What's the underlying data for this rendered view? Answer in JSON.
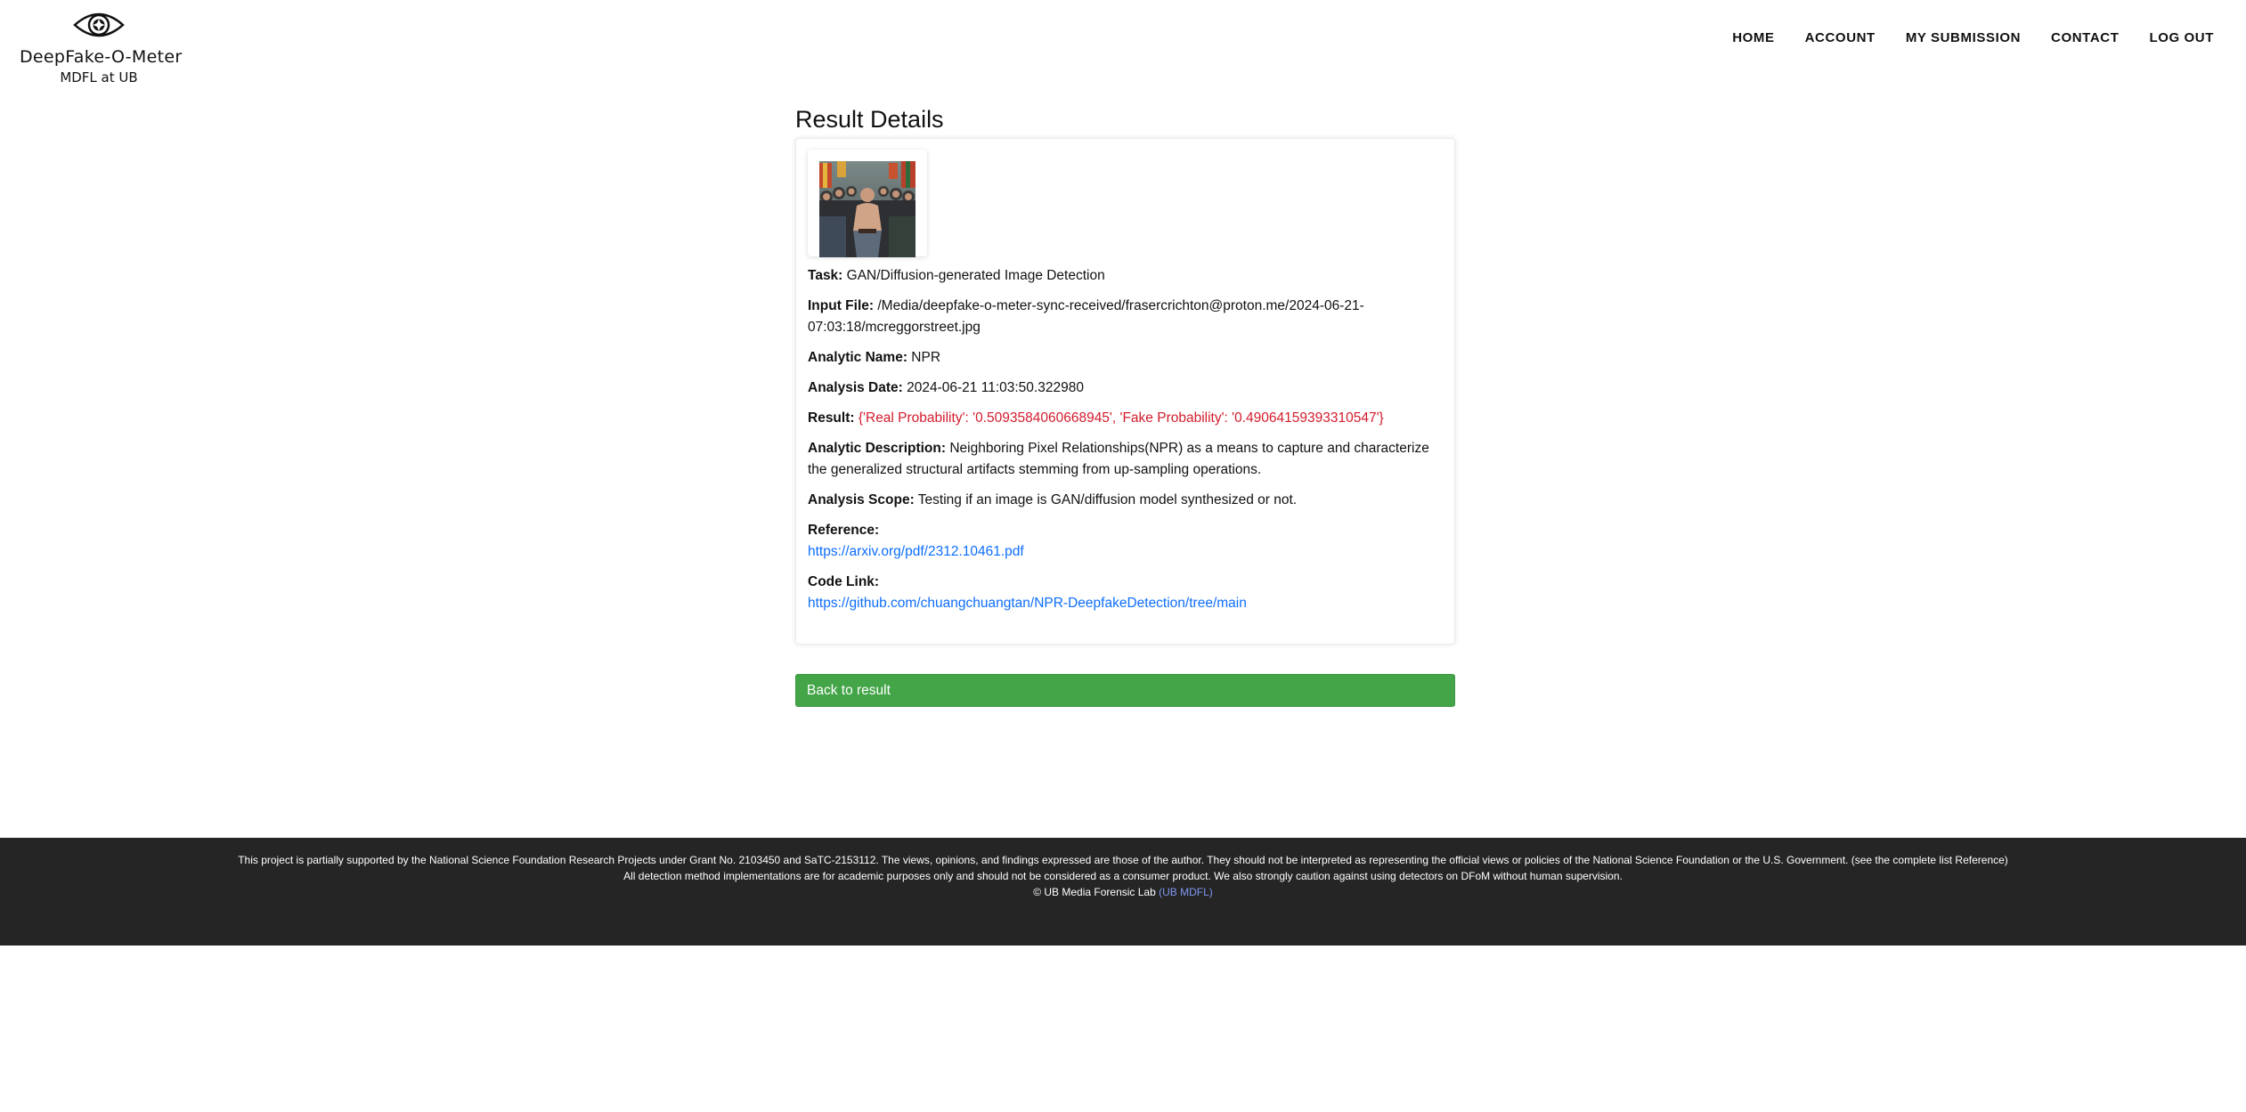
{
  "header": {
    "logo": {
      "title": "DeepFake-O-Meter",
      "subtitle": "MDFL at UB",
      "icon": "eye-icon"
    },
    "nav": [
      "HOME",
      "ACCOUNT",
      "MY SUBMISSION",
      "CONTACT",
      "LOG OUT"
    ]
  },
  "main": {
    "title": "Result Details",
    "fields": {
      "task": {
        "label": "Task:",
        "value": "GAN/Diffusion-generated Image Detection"
      },
      "input_file": {
        "label": "Input File:",
        "value": "/Media/deepfake-o-meter-sync-received/frasercrichton@proton.me/2024-06-21-07:03:18/mcreggorstreet.jpg"
      },
      "analytic_name": {
        "label": "Analytic Name:",
        "value": "NPR"
      },
      "analysis_date": {
        "label": "Analysis Date:",
        "value": "2024-06-21 11:03:50.322980"
      },
      "result": {
        "label": "Result:",
        "value": "{'Real Probability': '0.5093584060668945', 'Fake Probability': '0.49064159393310547'}",
        "color": "#d21c2c"
      },
      "analytic_description": {
        "label": "Analytic Description:",
        "value": "Neighboring Pixel Relationships(NPR) as a means to capture and characterize the generalized structural artifacts stemming from up-sampling operations."
      },
      "analysis_scope": {
        "label": "Analysis Scope:",
        "value": "Testing if an image is GAN/diffusion model synthesized or not."
      },
      "reference": {
        "label": "Reference:",
        "link": "https://arxiv.org/pdf/2312.10461.pdf"
      },
      "code_link": {
        "label": "Code Link:",
        "link": "https://github.com/chuangchuangtan/NPR-DeepfakeDetection/tree/main"
      }
    },
    "back_button": "Back to result",
    "button_color": "#43a548"
  },
  "footer": {
    "line1": "This project is partially supported by the National Science Foundation Research Projects under Grant No. 2103450 and SaTC-2153112. The views, opinions, and findings expressed are those of the author. They should not be interpreted as representing the official views or policies of the National Science Foundation or the U.S. Government. (see the complete list Reference)",
    "line2": "All detection method implementations are for academic purposes only and should not be considered as a consumer product. We also strongly caution against using detectors on DFoM without human supervision.",
    "copyright": "© UB Media Forensic Lab",
    "lab_link": "(UB MDFL)"
  }
}
